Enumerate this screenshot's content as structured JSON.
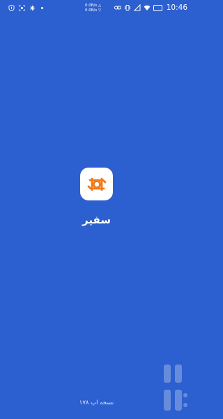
{
  "status_bar": {
    "net_speed_up": "0.0B/s △",
    "net_speed_down": "0.0B/s ▽",
    "battery_level": "",
    "time": "10:46",
    "icons": [
      "shield-icon",
      "screenshot-icon",
      "fan-icon",
      "notification-dot",
      "link-icon",
      "vibrate-icon",
      "signal-icon",
      "wifi-icon",
      "battery-icon"
    ]
  },
  "splash": {
    "app_name": "سفیر",
    "version_label": "نسخه اپ ۱۷۸",
    "logo_color": "#f07a1a",
    "background_color": "#2c5fcf",
    "watermark_text": "بازار"
  }
}
